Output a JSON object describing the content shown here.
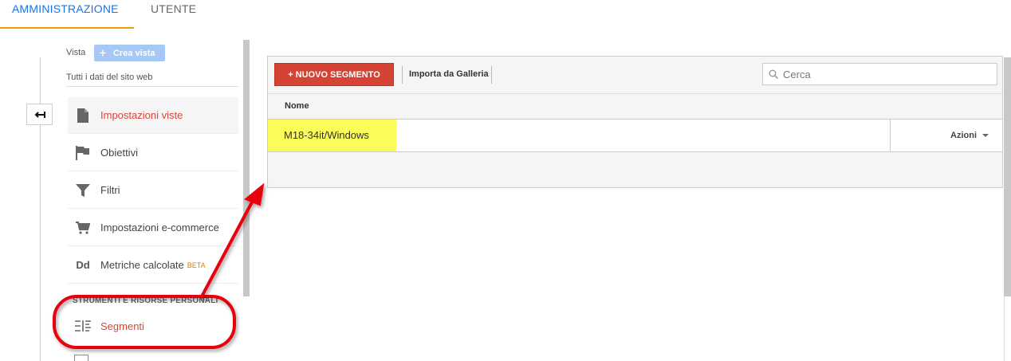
{
  "tabs": {
    "admin": "AMMINISTRAZIONE",
    "user": "UTENTE"
  },
  "sidebar": {
    "vista_label": "Vista",
    "create_view_label": "Crea vista",
    "view_name": "Tutti i dati del sito web",
    "items": [
      {
        "label": "Impostazioni viste",
        "icon": "document-icon",
        "active": true
      },
      {
        "label": "Obiettivi",
        "icon": "flag-icon"
      },
      {
        "label": "Filtri",
        "icon": "filter-icon"
      },
      {
        "label": "Impostazioni e-commerce",
        "icon": "cart-icon"
      },
      {
        "label": "Metriche calcolate",
        "icon": "dd-icon",
        "badge": "BETA"
      }
    ],
    "section_title": "STRUMENTI E RISORSE PERSONALI",
    "segments_label": "Segmenti"
  },
  "toolbar": {
    "new_segment": "+ NUOVO SEGMENTO",
    "import_gallery": "Importa da Galleria",
    "search_placeholder": "Cerca"
  },
  "table": {
    "columns": [
      "Nome"
    ],
    "rows": [
      {
        "name": "M18-34it/Windows",
        "actions": "Azioni"
      }
    ]
  },
  "colors": {
    "accent_blue": "#1a73e8",
    "tab_underline": "#f29900",
    "new_button": "#d54334",
    "highlight": "#fbfb5a",
    "annotation": "#e8000d"
  }
}
